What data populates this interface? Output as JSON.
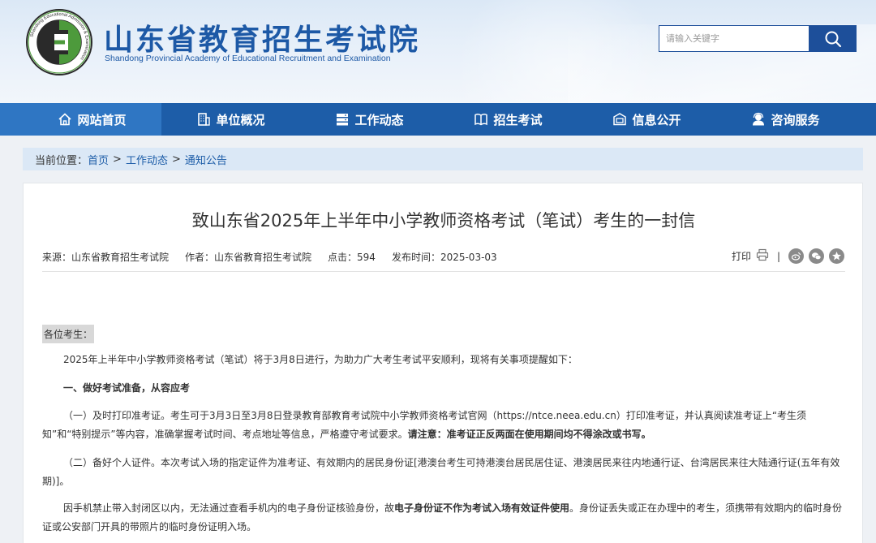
{
  "header": {
    "title": "山东省教育招生考试院",
    "subtitle": "Shandong Provincial Academy of Educational Recruitment and Examination",
    "logo_ring_text": "Shandong Educational Admission & Examination",
    "search_placeholder": "请输入关键字"
  },
  "nav": [
    {
      "label": "网站首页",
      "icon": "home-icon"
    },
    {
      "label": "单位概况",
      "icon": "building-icon"
    },
    {
      "label": "工作动态",
      "icon": "server-icon"
    },
    {
      "label": "招生考试",
      "icon": "book-icon"
    },
    {
      "label": "信息公开",
      "icon": "info-card-icon"
    },
    {
      "label": "咨询服务",
      "icon": "user-service-icon"
    }
  ],
  "breadcrumb": {
    "prefix": "当前位置：",
    "items": [
      "首页",
      "工作动态",
      "通知公告"
    ],
    "sep": ">"
  },
  "article": {
    "title": "致山东省2025年上半年中小学教师资格考试（笔试）考生的一封信",
    "meta": {
      "source": "来源：山东省教育招生考试院",
      "author": "作者：山东省教育招生考试院",
      "clicks": "点击：594",
      "date": "发布时间：2025-03-03"
    },
    "tools": {
      "print": "打印",
      "sep": "|"
    },
    "greeting": "各位考生：",
    "p1": "2025年上半年中小学教师资格考试（笔试）将于3月8日进行，为助力广大考生考试平安顺利，现将有关事项提醒如下：",
    "h1": "一、做好考试准备，从容应考",
    "p2_text": "（一）及时打印准考证。考生可于3月3日至3月8日登录教育部教育考试院中小学教师资格考试官网（https://ntce.neea.edu.cn）打印准考证，并认真阅读准考证上“考生须知”和“特别提示”等内容，准确掌握考试时间、考点地址等信息，严格遵守考试要求。",
    "p2_bold": "请注意：准考证正反两面在使用期间均不得涂改或书写。",
    "p3": "（二）备好个人证件。本次考试入场的指定证件为准考证、有效期内的居民身份证[港澳台考生可持港澳台居民居住证、港澳居民来往内地通行证、台湾居民来往大陆通行证(五年有效期)]。",
    "p4_a": "因手机禁止带入封闭区以内，无法通过查看手机内的电子身份证核验身份，故",
    "p4_bold": "电子身份证不作为考试入场有效证件使用",
    "p4_b": "。身份证丢失或正在办理中的考生，须携带有效期内的临时身份证或公安部门开具的带照片的临时身份证明入场。"
  },
  "colors": {
    "nav": "#1d5da8",
    "nav_active": "#2f76c3",
    "brand": "#1d59a6"
  }
}
